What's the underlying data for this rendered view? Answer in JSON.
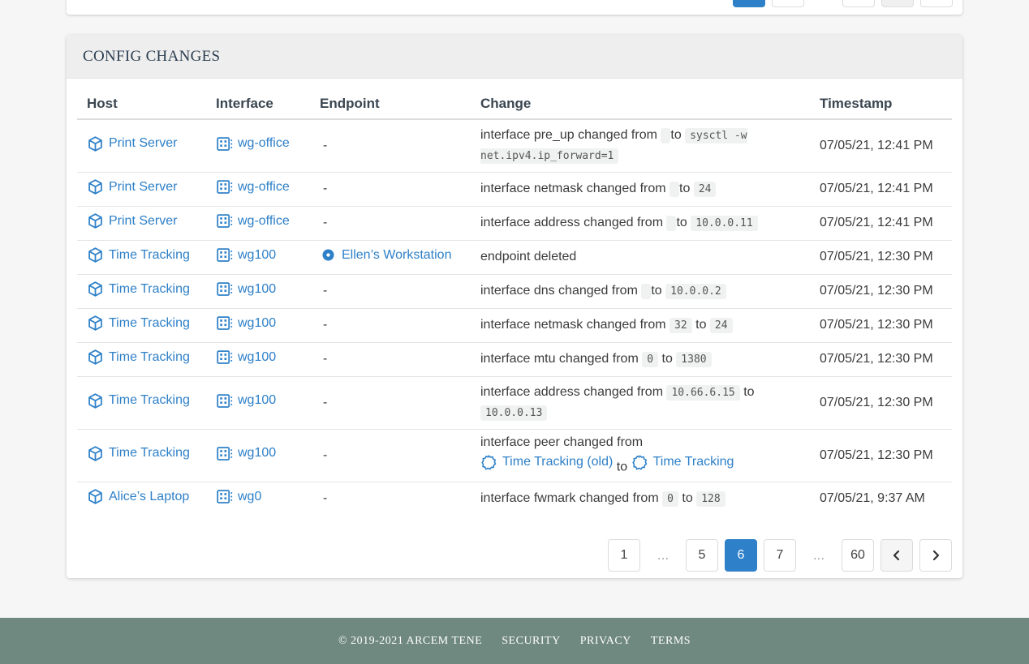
{
  "section": {
    "title": "CONFIG CHANGES"
  },
  "table": {
    "headers": {
      "host": "Host",
      "interface": "Interface",
      "endpoint": "Endpoint",
      "change": "Change",
      "timestamp": "Timestamp"
    },
    "rows": [
      {
        "host": "Print Server",
        "interface": "wg-office",
        "endpoint": "-",
        "prefix": "interface pre_up changed from",
        "from": "",
        "to_word": "to",
        "to": "sysctl -w net.ipv4.ip_forward=1",
        "timestamp": "07/05/21, 12:41 PM"
      },
      {
        "host": "Print Server",
        "interface": "wg-office",
        "endpoint": "-",
        "prefix": "interface netmask changed from",
        "from": "",
        "to_word": "to",
        "to": "24",
        "timestamp": "07/05/21, 12:41 PM"
      },
      {
        "host": "Print Server",
        "interface": "wg-office",
        "endpoint": "-",
        "prefix": "interface address changed from",
        "from": "",
        "to_word": "to",
        "to": "10.0.0.11",
        "timestamp": "07/05/21, 12:41 PM"
      },
      {
        "host": "Time Tracking",
        "interface": "wg100",
        "endpoint": "Ellen’s Workstation",
        "prefix": "endpoint deleted",
        "timestamp": "07/05/21, 12:30 PM"
      },
      {
        "host": "Time Tracking",
        "interface": "wg100",
        "endpoint": "-",
        "prefix": "interface dns changed from",
        "from": "",
        "to_word": "to",
        "to": "10.0.0.2",
        "timestamp": "07/05/21, 12:30 PM"
      },
      {
        "host": "Time Tracking",
        "interface": "wg100",
        "endpoint": "-",
        "prefix": "interface netmask changed from",
        "from": "32",
        "to_word": "to",
        "to": "24",
        "timestamp": "07/05/21, 12:30 PM"
      },
      {
        "host": "Time Tracking",
        "interface": "wg100",
        "endpoint": "-",
        "prefix": "interface mtu changed from",
        "from": "0",
        "to_word": "to",
        "to": "1380",
        "timestamp": "07/05/21, 12:30 PM"
      },
      {
        "host": "Time Tracking",
        "interface": "wg100",
        "endpoint": "-",
        "prefix": "interface address changed from",
        "from": "10.66.6.15",
        "to_word": "to",
        "to": "10.0.0.13",
        "timestamp": "07/05/21, 12:30 PM"
      },
      {
        "host": "Time Tracking",
        "interface": "wg100",
        "endpoint": "-",
        "prefix": "interface peer changed from",
        "from_link": "Time Tracking (old)",
        "to_word": "to",
        "to_link": "Time Tracking",
        "timestamp": "07/05/21, 12:30 PM"
      },
      {
        "host": "Alice’s Laptop",
        "interface": "wg0",
        "endpoint": "-",
        "prefix": "interface fwmark changed from",
        "from": "0",
        "to_word": "to",
        "to": "128",
        "timestamp": "07/05/21, 9:37 AM"
      }
    ]
  },
  "pagination": {
    "pages": [
      "1",
      "…",
      "5",
      "6",
      "7",
      "…",
      "60"
    ],
    "active": "6",
    "prev_icon": "chevron-left-icon",
    "next_icon": "chevron-right-icon"
  },
  "footer": {
    "copyright": "© 2019-2021 ARCEM TENE",
    "links": [
      "SECURITY",
      "PRIVACY",
      "TERMS"
    ]
  },
  "colors": {
    "accent": "#2e80c8",
    "footer": "#6f8880",
    "header_bg": "#eeeeee"
  }
}
